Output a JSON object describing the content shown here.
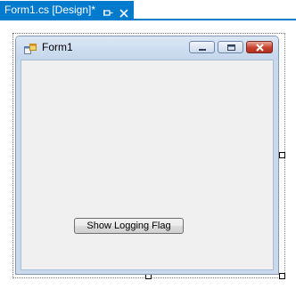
{
  "document_tab": {
    "title": "Form1.cs [Design]*",
    "pin_icon": "pin-icon",
    "close_icon": "close-icon"
  },
  "form": {
    "title": "Form1",
    "icon": "form-icon",
    "caption_buttons": [
      "minimize",
      "maximize",
      "close"
    ],
    "button_label": "Show Logging Flag"
  },
  "colors": {
    "tab_accent": "#007acc",
    "form_frame": "#c9daed",
    "client_background": "#f0f0f0",
    "close_button": "#c7422e"
  }
}
